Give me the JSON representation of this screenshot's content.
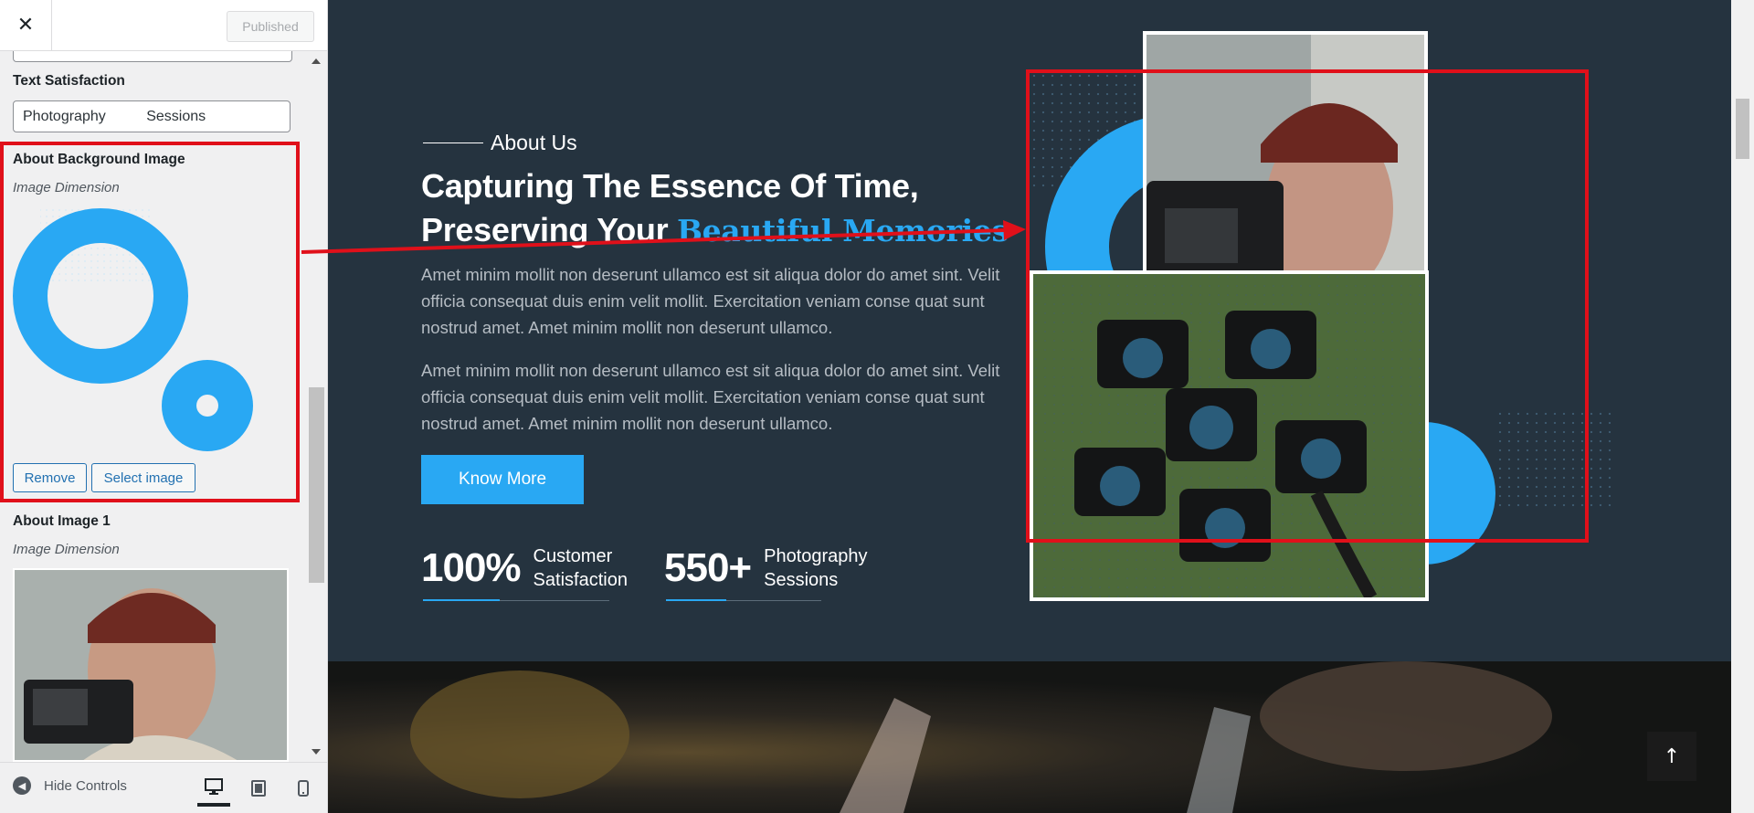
{
  "header": {
    "close_glyph": "✕",
    "publish_label": "Published"
  },
  "controls": {
    "text_satisfaction": {
      "label": "Text Satisfaction",
      "value": "Photography          Sessions"
    },
    "about_background_image": {
      "label": "About Background Image",
      "description": "Image Dimension",
      "remove_label": "Remove",
      "select_label": "Select image"
    },
    "about_image_1": {
      "label": "About Image 1",
      "description": "Image Dimension"
    }
  },
  "footer": {
    "hide_controls_label": "Hide Controls",
    "devices": [
      "desktop-icon",
      "tablet-icon",
      "mobile-icon"
    ],
    "active_device": "desktop"
  },
  "preview": {
    "eyebrow": "About Us",
    "headline_line1": "Capturing The Essence Of Time,",
    "headline_line2_plain": "Preserving Your ",
    "headline_line2_accent": "Beautiful Memories",
    "paragraph1": "Amet minim mollit non deserunt ullamco est sit aliqua dolor do amet sint. Velit officia consequat duis enim velit mollit. Exercitation veniam conse quat sunt nostrud amet. Amet minim mollit non deserunt ullamco.",
    "paragraph2": "Amet minim mollit non deserunt ullamco est sit aliqua dolor do amet sint. Velit officia consequat duis enim velit mollit. Exercitation veniam conse quat sunt nostrud amet. Amet minim mollit non deserunt ullamco.",
    "cta_label": "Know More",
    "stats": [
      {
        "number": "100%",
        "label": "Customer Satisfaction"
      },
      {
        "number": "550+",
        "label": "Photography Sessions"
      }
    ],
    "to_top_glyph": "↑"
  },
  "colors": {
    "accent": "#29a8f3",
    "background": "#25333f",
    "highlight": "#e0101a",
    "panel": "#f0f0f1",
    "link": "#2271b1"
  }
}
